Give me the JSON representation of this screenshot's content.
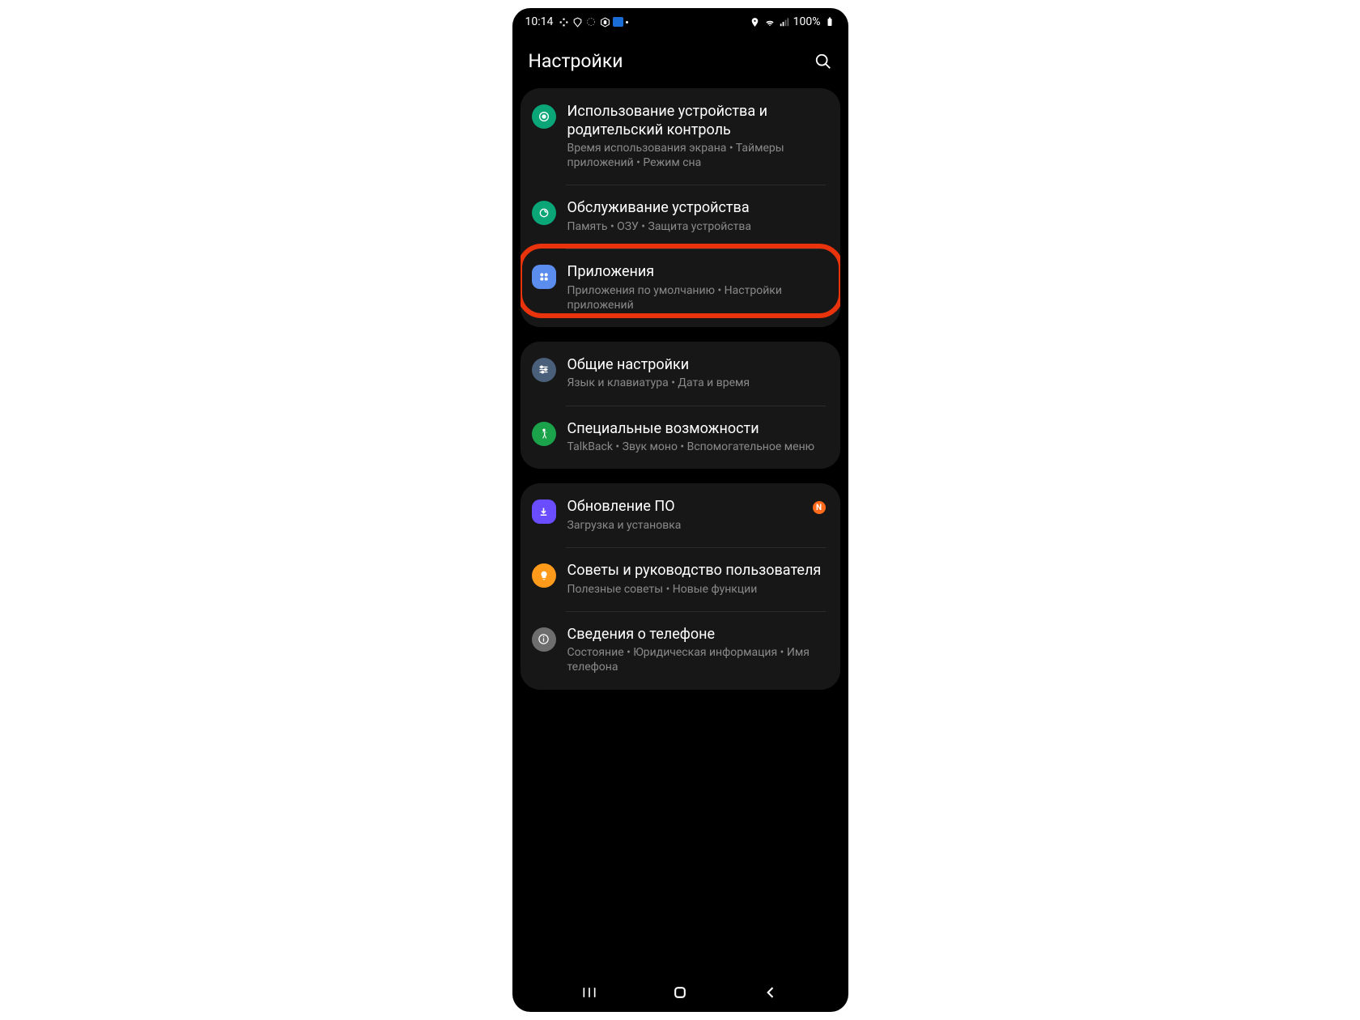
{
  "status": {
    "time": "10:14",
    "battery": "100%"
  },
  "header": {
    "title": "Настройки"
  },
  "groups": [
    {
      "items": [
        {
          "title": "Использование устройства и родительский контроль",
          "subtitle": "Время использования экрана  •  Таймеры приложений  •  Режим сна",
          "iconClass": "ic-green1",
          "iconName": "digital-wellbeing-icon"
        },
        {
          "title": "Обслуживание устройства",
          "subtitle": "Память  •  ОЗУ  •  Защита устройства",
          "iconClass": "ic-teal",
          "iconName": "device-care-icon"
        },
        {
          "title": "Приложения",
          "subtitle": "Приложения по умолчанию  •  Настройки приложений",
          "iconClass": "ic-blue",
          "iconName": "apps-icon",
          "highlighted": true
        }
      ]
    },
    {
      "items": [
        {
          "title": "Общие настройки",
          "subtitle": "Язык и клавиатура  •  Дата и время",
          "iconClass": "ic-bluegrey",
          "iconName": "general-settings-icon"
        },
        {
          "title": "Специальные возможности",
          "subtitle": "TalkBack  •  Звук моно  •  Вспомогательное меню",
          "iconClass": "ic-green2",
          "iconName": "accessibility-icon"
        }
      ]
    },
    {
      "items": [
        {
          "title": "Обновление ПО",
          "subtitle": "Загрузка и установка",
          "iconClass": "ic-violet",
          "iconName": "software-update-icon",
          "badge": "N"
        },
        {
          "title": "Советы и руководство пользователя",
          "subtitle": "Полезные советы  •  Новые функции",
          "iconClass": "ic-orange",
          "iconName": "tips-icon"
        },
        {
          "title": "Сведения о телефоне",
          "subtitle": "Состояние  •  Юридическая информация  •  Имя телефона",
          "iconClass": "ic-grey",
          "iconName": "about-phone-icon"
        }
      ]
    }
  ]
}
